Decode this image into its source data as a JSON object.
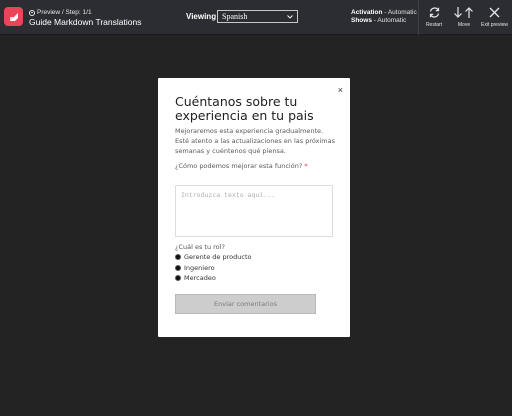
{
  "topbar": {
    "breadcrumb": "Preview / Step: 1/1",
    "guide_title": "Guide Markdown Translations",
    "viewing_label": "Viewing",
    "language_selected": "Spanish",
    "activation_label": "Activation",
    "activation_value": " - Automatic",
    "shows_label": "Shows",
    "shows_value": " - Automatic",
    "tools": {
      "restart": "Restart",
      "move": "Move",
      "exit": "Exit preview"
    },
    "icons": [
      "logo-icon",
      "eye-icon",
      "chevron-down-icon",
      "restart-icon",
      "arrow-down-icon",
      "arrow-up-icon",
      "close-icon"
    ],
    "brand_color": "#e8445a"
  },
  "dialog": {
    "close": "×",
    "title": "Cuéntanos sobre tu experiencia en tu pais",
    "description": "Mejoraremos esta experiencia gradualmente. Esté atento a las actualizaciones en las próximas semanas y cuéntenos qué piensa.",
    "question": "¿Cómo podemos mejorar esta función?",
    "required_mark": "*",
    "textarea_placeholder": "Introduzca texto aquí...",
    "role_question": "¿Cuál es tu rol?",
    "options": [
      "Gerente de producto",
      "Ingeniero",
      "Mercadeo"
    ],
    "submit_label": "Enviar comentarios"
  }
}
